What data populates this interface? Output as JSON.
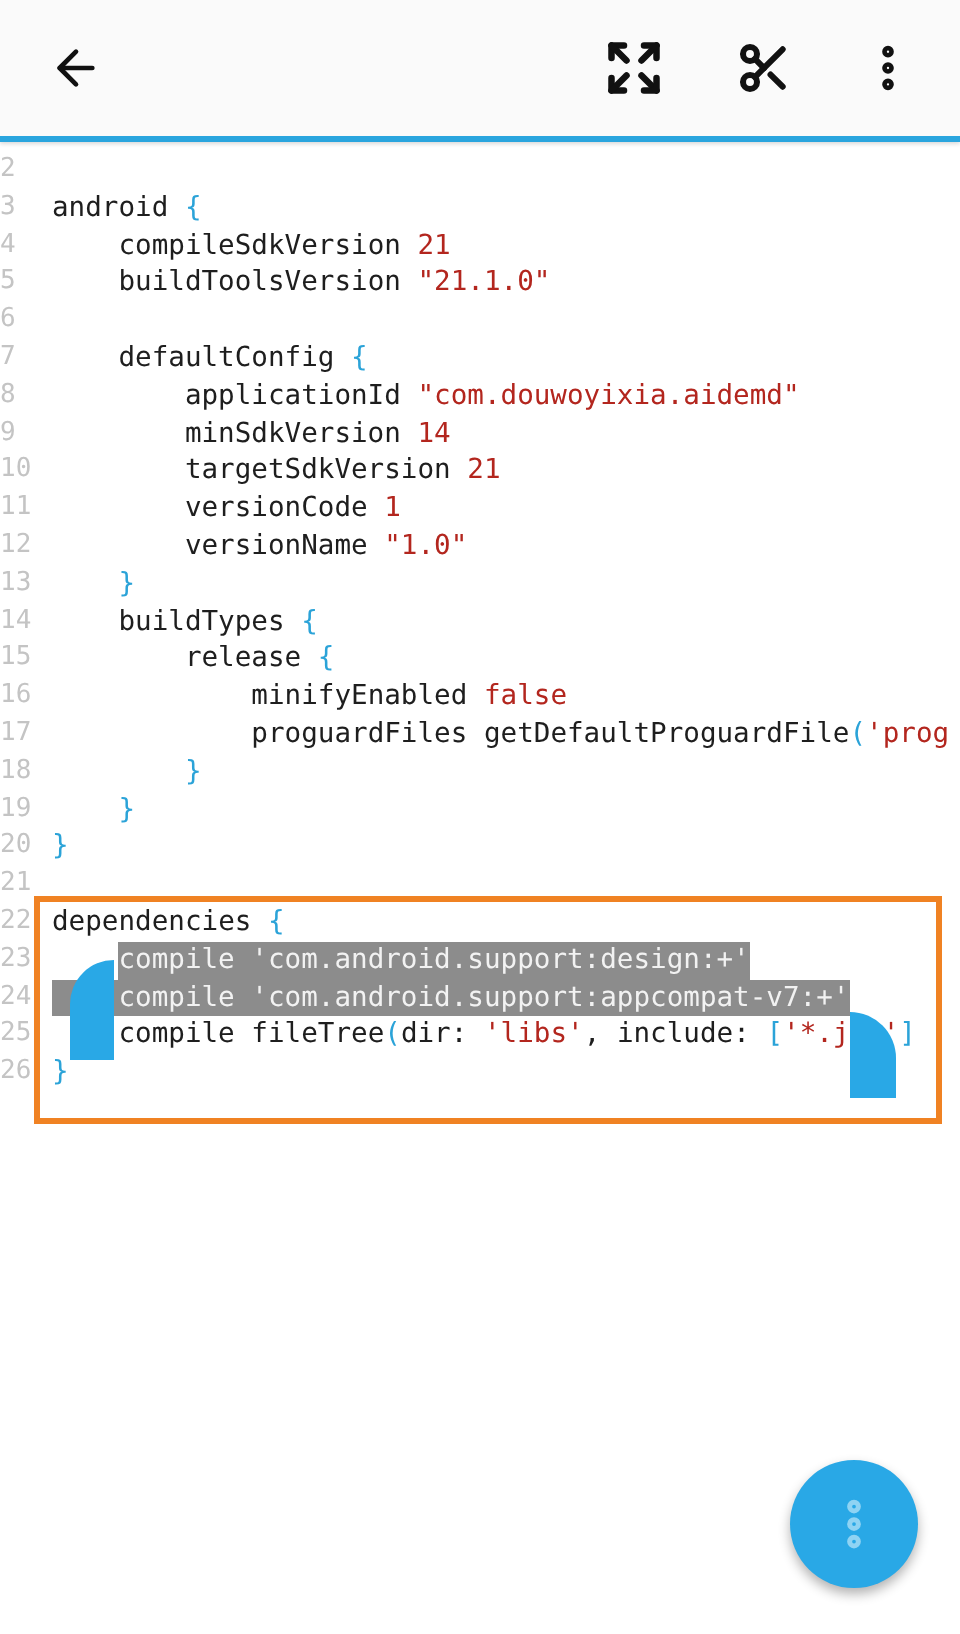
{
  "editor": {
    "lines": [
      {
        "number": "2"
      },
      {
        "number": "3",
        "tokens": [
          {
            "text": "android ",
            "kind": "plain"
          },
          {
            "text": "{",
            "kind": "brace"
          }
        ],
        "children": [
          {
            "number": "4",
            "tokens": [
              {
                "text": "compileSdkVersion ",
                "kind": "plain"
              },
              {
                "text": "21",
                "kind": "value"
              }
            ]
          },
          {
            "number": "5",
            "tokens": [
              {
                "text": "buildToolsVersion ",
                "kind": "plain"
              },
              {
                "text": "\"21.1.0\"",
                "kind": "value"
              }
            ]
          },
          {
            "number": "6"
          },
          {
            "number": "7",
            "tokens": [
              {
                "text": "defaultConfig ",
                "kind": "plain"
              },
              {
                "text": "{",
                "kind": "brace"
              }
            ],
            "children": [
              {
                "number": "8",
                "tokens": [
                  {
                    "text": "applicationId ",
                    "kind": "plain"
                  },
                  {
                    "text": "\"com.douwoyixia.aidemd\"",
                    "kind": "value"
                  }
                ]
              },
              {
                "number": "9",
                "tokens": [
                  {
                    "text": "minSdkVersion ",
                    "kind": "plain"
                  },
                  {
                    "text": "14",
                    "kind": "value"
                  }
                ]
              },
              {
                "number": "10",
                "tokens": [
                  {
                    "text": "targetSdkVersion ",
                    "kind": "plain"
                  },
                  {
                    "text": "21",
                    "kind": "value"
                  }
                ]
              },
              {
                "number": "11",
                "tokens": [
                  {
                    "text": "versionCode ",
                    "kind": "plain"
                  },
                  {
                    "text": "1",
                    "kind": "value"
                  }
                ]
              },
              {
                "number": "12",
                "tokens": [
                  {
                    "text": "versionName ",
                    "kind": "plain"
                  },
                  {
                    "text": "\"1.0\"",
                    "kind": "value"
                  }
                ]
              }
            ]
          },
          {
            "number": "13",
            "tokens": [
              {
                "text": "}",
                "kind": "brace"
              }
            ]
          },
          {
            "number": "14",
            "tokens": [
              {
                "text": "buildTypes ",
                "kind": "plain"
              },
              {
                "text": "{",
                "kind": "brace"
              }
            ],
            "children": [
              {
                "number": "15",
                "tokens": [
                  {
                    "text": "release ",
                    "kind": "plain"
                  },
                  {
                    "text": "{",
                    "kind": "brace"
                  }
                ],
                "children": [
                  {
                    "number": "16",
                    "tokens": [
                      {
                        "text": "minifyEnabled ",
                        "kind": "plain"
                      },
                      {
                        "text": "false",
                        "kind": "value"
                      }
                    ]
                  },
                  {
                    "number": "17",
                    "tokens": [
                      {
                        "text": "proguardFiles getDefaultProguardFile",
                        "kind": "plain"
                      },
                      {
                        "text": "(",
                        "kind": "brace"
                      },
                      {
                        "text": "'prog",
                        "kind": "value"
                      }
                    ]
                  }
                ]
              },
              {
                "number": "18",
                "tokens": [
                  {
                    "text": "}",
                    "kind": "brace"
                  }
                ]
              }
            ]
          },
          {
            "number": "19",
            "tokens": [
              {
                "text": "}",
                "kind": "brace"
              }
            ]
          }
        ]
      },
      {
        "number": "20",
        "tokens": [
          {
            "text": "}",
            "kind": "brace"
          }
        ]
      },
      {
        "number": "21"
      },
      {
        "number": "22",
        "boxed": true,
        "selected": false,
        "tokens": [
          {
            "text": "dependencies ",
            "kind": "plain"
          },
          {
            "text": "{",
            "kind": "brace"
          }
        ],
        "children": [
          {
            "number": "23",
            "boxed": true,
            "selected": true,
            "tokens": [
              {
                "text": "compile ",
                "kind": "plain"
              },
              {
                "text": "'com.android.support:design:+'",
                "kind": "value"
              }
            ]
          },
          {
            "number": "24",
            "boxed": true,
            "selected": true,
            "indent_selected": true,
            "tokens": [
              {
                "text": "compile ",
                "kind": "plain"
              },
              {
                "text": "'com.android.support:appcompat-v7:+'",
                "kind": "value"
              }
            ]
          },
          {
            "number": "25",
            "boxed": true,
            "selected": false,
            "tokens": [
              {
                "kind": "handle_start"
              },
              {
                "text": "compile fileTree",
                "kind": "plain"
              },
              {
                "text": "(",
                "kind": "brace"
              },
              {
                "text": "dir: ",
                "kind": "plain"
              },
              {
                "text": "'libs'",
                "kind": "value"
              },
              {
                "text": ", include: ",
                "kind": "plain"
              },
              {
                "text": "[",
                "kind": "brace"
              },
              {
                "text": "'*.j",
                "kind": "value"
              },
              {
                "kind": "handle_end"
              },
              {
                "text": "'",
                "kind": "value"
              },
              {
                "text": "]",
                "kind": "brace"
              }
            ]
          }
        ]
      },
      {
        "number": "26",
        "boxed": true,
        "selected": false,
        "tokens": [
          {
            "text": "}",
            "kind": "brace"
          }
        ]
      }
    ]
  }
}
